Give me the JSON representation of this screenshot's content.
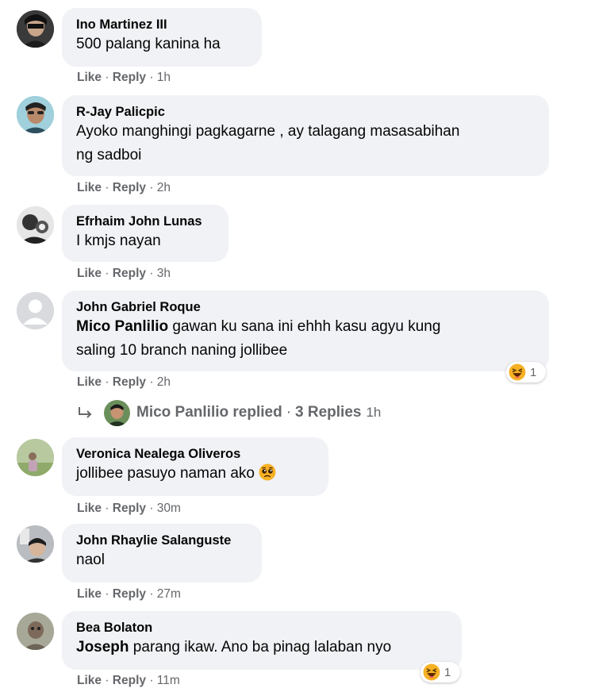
{
  "actions": {
    "like": "Like",
    "reply": "Reply",
    "separator": "·"
  },
  "comments": [
    {
      "author": "Ino Martinez III",
      "text": "500 palang kanina ha",
      "time": "1h"
    },
    {
      "author": "R-Jay Palicpic",
      "text_line1": "Ayoko manghingi pagkagarne , ay talagang masasabihan",
      "text_line2": "ng sadboi",
      "time": "2h"
    },
    {
      "author": "Efrhaim John Lunas",
      "text": "I kmjs nayan",
      "time": "3h"
    },
    {
      "author": "John Gabriel Roque",
      "mention": "Mico Panlilio",
      "text_line1": " gawan ku sana ini ehhh kasu agyu kung",
      "text_line2": "saling 10 branch naning jollibee",
      "time": "2h",
      "reaction_icon": "haha-emoji",
      "reaction_count": "1"
    },
    {
      "author": "Veronica Nealega Oliveros",
      "text": "jollibee pasuyo naman ako",
      "emoji": "pleading-face-emoji",
      "time": "30m"
    },
    {
      "author": "John Rhaylie Salanguste",
      "text": "naol",
      "time": "27m"
    },
    {
      "author": "Bea Bolaton",
      "mention": "Joseph",
      "text": " parang ikaw. Ano ba pinag lalaban nyo",
      "time": "11m",
      "reaction_icon": "haha-emoji",
      "reaction_count": "1"
    }
  ],
  "replies": {
    "arrow_icon": "reply-arrow-icon",
    "name": "Mico Panlilio replied",
    "separator": "·",
    "count": "3 Replies",
    "time": "1h"
  },
  "colors": {
    "bubble": "#f0f2f5",
    "meta": "#65676b",
    "text": "#050505",
    "haha": "#f7b125"
  }
}
